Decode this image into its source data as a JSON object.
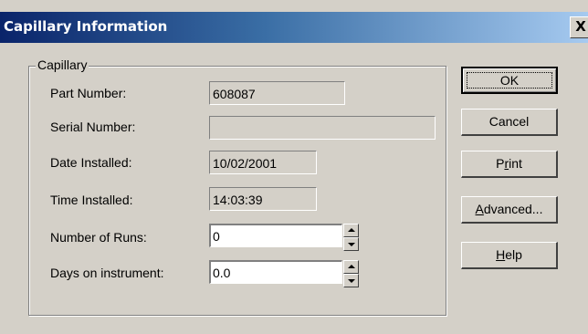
{
  "window": {
    "title": "Capillary Information",
    "close_glyph": "X"
  },
  "group": {
    "label": "Capillary"
  },
  "fields": {
    "part_number": {
      "label": "Part Number:",
      "value": "608087"
    },
    "serial_number": {
      "label": "Serial Number:",
      "value": ""
    },
    "date_installed": {
      "label": "Date Installed:",
      "value": "10/02/2001"
    },
    "time_installed": {
      "label": "Time Installed:",
      "value": "14:03:39"
    },
    "number_of_runs": {
      "label": "Number of Runs:",
      "value": "0"
    },
    "days_on_instrument": {
      "label": "Days on instrument:",
      "value": "0.0"
    }
  },
  "buttons": {
    "ok": "OK",
    "cancel": "Cancel",
    "print_pre": "P",
    "print_u": "r",
    "print_post": "int",
    "advanced_pre": "",
    "advanced_u": "A",
    "advanced_post": "dvanced...",
    "help_pre": "",
    "help_u": "H",
    "help_post": "elp"
  }
}
